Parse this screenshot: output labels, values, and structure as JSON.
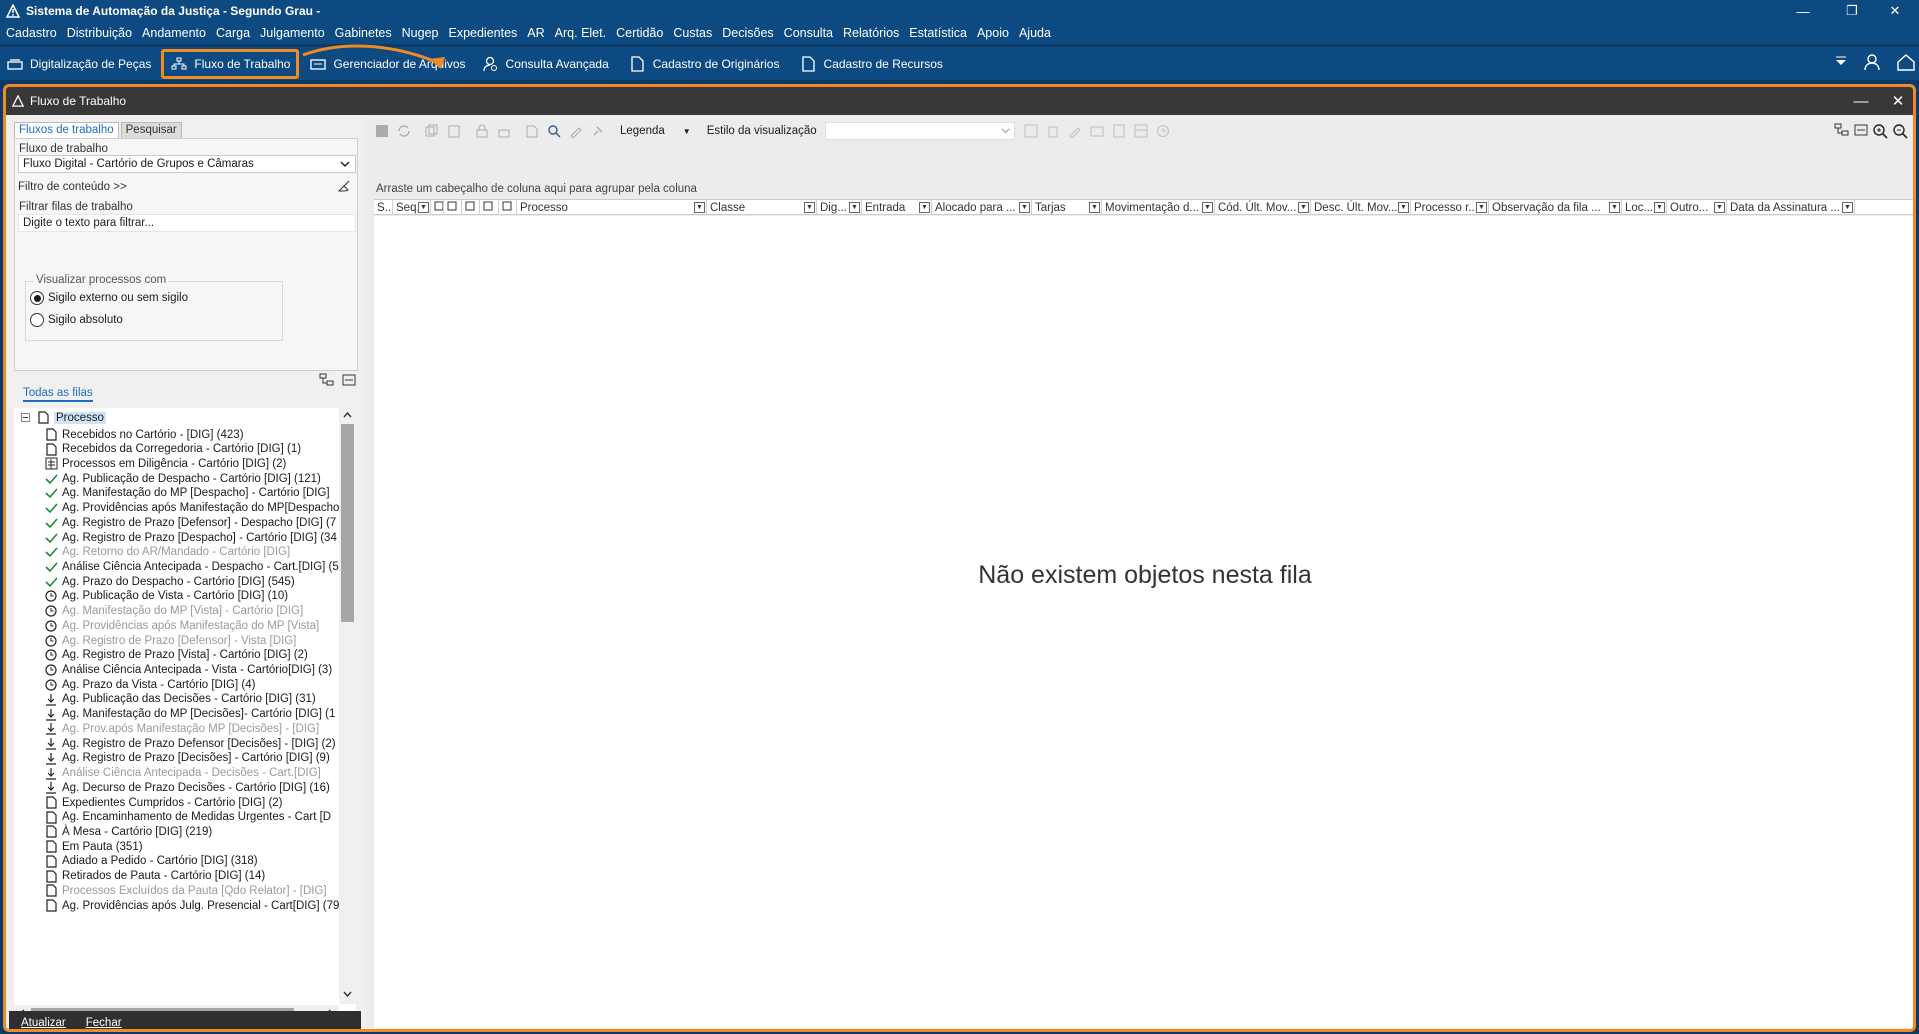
{
  "window": {
    "title": "Sistema de Automação da Justiça - Segundo Grau -"
  },
  "menu": [
    "Cadastro",
    "Distribuição",
    "Andamento",
    "Carga",
    "Julgamento",
    "Gabinetes",
    "Nugep",
    "Expedientes",
    "AR",
    "Arq. Elet.",
    "Certidão",
    "Custas",
    "Decisões",
    "Consulta",
    "Relatórios",
    "Estatística",
    "Apoio",
    "Ajuda"
  ],
  "toolbar": [
    {
      "label": "Digitalização de Peças",
      "icon": "scanner-icon"
    },
    {
      "label": "Fluxo de Trabalho",
      "icon": "workflow-icon",
      "active": true
    },
    {
      "label": "Gerenciador de Arquivos",
      "icon": "file-manager-icon"
    },
    {
      "label": "Consulta Avançada",
      "icon": "user-search-icon"
    },
    {
      "label": "Cadastro de Originários",
      "icon": "document-icon"
    },
    {
      "label": "Cadastro de Recursos",
      "icon": "document-icon"
    }
  ],
  "inner_window": {
    "title": "Fluxo de Trabalho"
  },
  "left": {
    "tabs": [
      "Fluxos de trabalho",
      "Pesquisar"
    ],
    "flow_label": "Fluxo de trabalho",
    "flow_value": "Fluxo Digital - Cartório de Grupos e Câmaras",
    "content_filter": "Filtro de conteúdo >>",
    "filter_label": "Filtrar filas de trabalho",
    "filter_placeholder": "Digite o texto para filtrar...",
    "view_group": "Visualizar processos com",
    "radio1": "Sigilo externo ou sem sigilo",
    "radio2": "Sigilo absoluto",
    "all_queues": "Todas as filas",
    "root": "Processo",
    "queues": [
      {
        "t": "Recebidos no Cartório - [DIG] (423)",
        "i": "doc",
        "dim": false
      },
      {
        "t": "Recebidos da Corregedoria - Cartório [DIG] (1)",
        "i": "doc",
        "dim": false
      },
      {
        "t": "Processos em Diligência - Cartório [DIG] (2)",
        "i": "dil",
        "dim": false
      },
      {
        "t": "Ag. Publicação de Despacho - Cartório [DIG] (121)",
        "i": "check",
        "dim": false
      },
      {
        "t": "Ag. Manifestação do MP [Despacho] - Cartório [DIG]",
        "i": "check",
        "dim": false
      },
      {
        "t": "Ag. Providências após Manifestação do MP[Despacho",
        "i": "check",
        "dim": false
      },
      {
        "t": "Ag. Registro de Prazo [Defensor] - Despacho [DIG] (7",
        "i": "check",
        "dim": false
      },
      {
        "t": "Ag. Registro de Prazo [Despacho] - Cartório [DIG] (34",
        "i": "check",
        "dim": false
      },
      {
        "t": "Ag. Retorno do AR/Mandado - Cartório [DIG]",
        "i": "check",
        "dim": true
      },
      {
        "t": "Análise Ciência Antecipada - Despacho - Cart.[DIG] (5",
        "i": "check",
        "dim": false
      },
      {
        "t": "Ag. Prazo do Despacho - Cartório [DIG] (545)",
        "i": "check",
        "dim": false
      },
      {
        "t": "Ag. Publicação de Vista - Cartório [DIG] (10)",
        "i": "clock",
        "dim": false
      },
      {
        "t": "Ag. Manifestação do MP [Vista] - Cartório [DIG]",
        "i": "clock",
        "dim": true
      },
      {
        "t": "Ag. Providências após Manifestação do MP [Vista]",
        "i": "clock",
        "dim": true
      },
      {
        "t": "Ag. Registro de Prazo [Defensor] - Vista [DIG]",
        "i": "clock",
        "dim": true
      },
      {
        "t": "Ag. Registro de Prazo [Vista] - Cartório [DIG] (2)",
        "i": "clock",
        "dim": false
      },
      {
        "t": "Análise Ciência Antecipada - Vista - Cartório[DIG] (3)",
        "i": "clock",
        "dim": false
      },
      {
        "t": "Ag. Prazo da Vista - Cartório [DIG] (4)",
        "i": "clock",
        "dim": false
      },
      {
        "t": "Ag. Publicação das Decisões - Cartório [DIG] (31)",
        "i": "down",
        "dim": false
      },
      {
        "t": "Ag. Manifestação do MP [Decisões]- Cartório [DIG] (1",
        "i": "down",
        "dim": false
      },
      {
        "t": "Ag. Prov.após Manifestação MP [Decisões] - [DIG]",
        "i": "down",
        "dim": true
      },
      {
        "t": "Ag. Registro de Prazo Defensor [Decisões] - [DIG] (2)",
        "i": "down",
        "dim": false
      },
      {
        "t": "Ag. Registro de Prazo [Decisões] - Cartório [DIG] (9)",
        "i": "down",
        "dim": false
      },
      {
        "t": "Análise Ciência Antecipada - Decisões - Cart.[DIG]",
        "i": "down",
        "dim": true
      },
      {
        "t": "Ag. Decurso de Prazo Decisões - Cartório [DIG] (16)",
        "i": "down",
        "dim": false
      },
      {
        "t": "Expedientes Cumpridos - Cartório [DIG] (2)",
        "i": "doc",
        "dim": false
      },
      {
        "t": "Ag. Encaminhamento de Medidas Urgentes - Cart [D",
        "i": "doc",
        "dim": false
      },
      {
        "t": "À Mesa - Cartório [DIG] (219)",
        "i": "doc",
        "dim": false
      },
      {
        "t": "Em Pauta (351)",
        "i": "doc",
        "dim": false
      },
      {
        "t": "Adiado a Pedido - Cartório [DIG] (318)",
        "i": "doc",
        "dim": false
      },
      {
        "t": "Retirados de Pauta - Cartório [DIG] (14)",
        "i": "doc",
        "dim": false
      },
      {
        "t": "Processos Excluídos da Pauta [Qdo Relator] - [DIG]",
        "i": "doc",
        "dim": true
      },
      {
        "t": "Ag. Providências após Julg. Presencial - Cart[DIG] (79",
        "i": "doc",
        "dim": false
      }
    ],
    "buttons": [
      "Atualizar",
      "Fechar"
    ]
  },
  "right": {
    "legend": "Legenda",
    "view_style": "Estilo da visualização",
    "group_hint": "Arraste um cabeçalho de coluna aqui para agrupar pela coluna",
    "columns": [
      "S...",
      "Seq.",
      "",
      "",
      "",
      "",
      "",
      "Processo",
      "Classe",
      "Dig...",
      "Entrada",
      "Alocado para ...",
      "Tarjas",
      "Movimentação d...",
      "Cód. Últ. Mov...",
      "Desc. Últ. Mov...",
      "Processo r...",
      "Observação da fila ...",
      "Loc...",
      "Outro...",
      "Data da Assinatura ..."
    ],
    "empty_message": "Não existem objetos nesta fila"
  },
  "colors": {
    "brand": "#0e4a82",
    "highlight": "#f08a24",
    "link": "#1f6cc4"
  }
}
